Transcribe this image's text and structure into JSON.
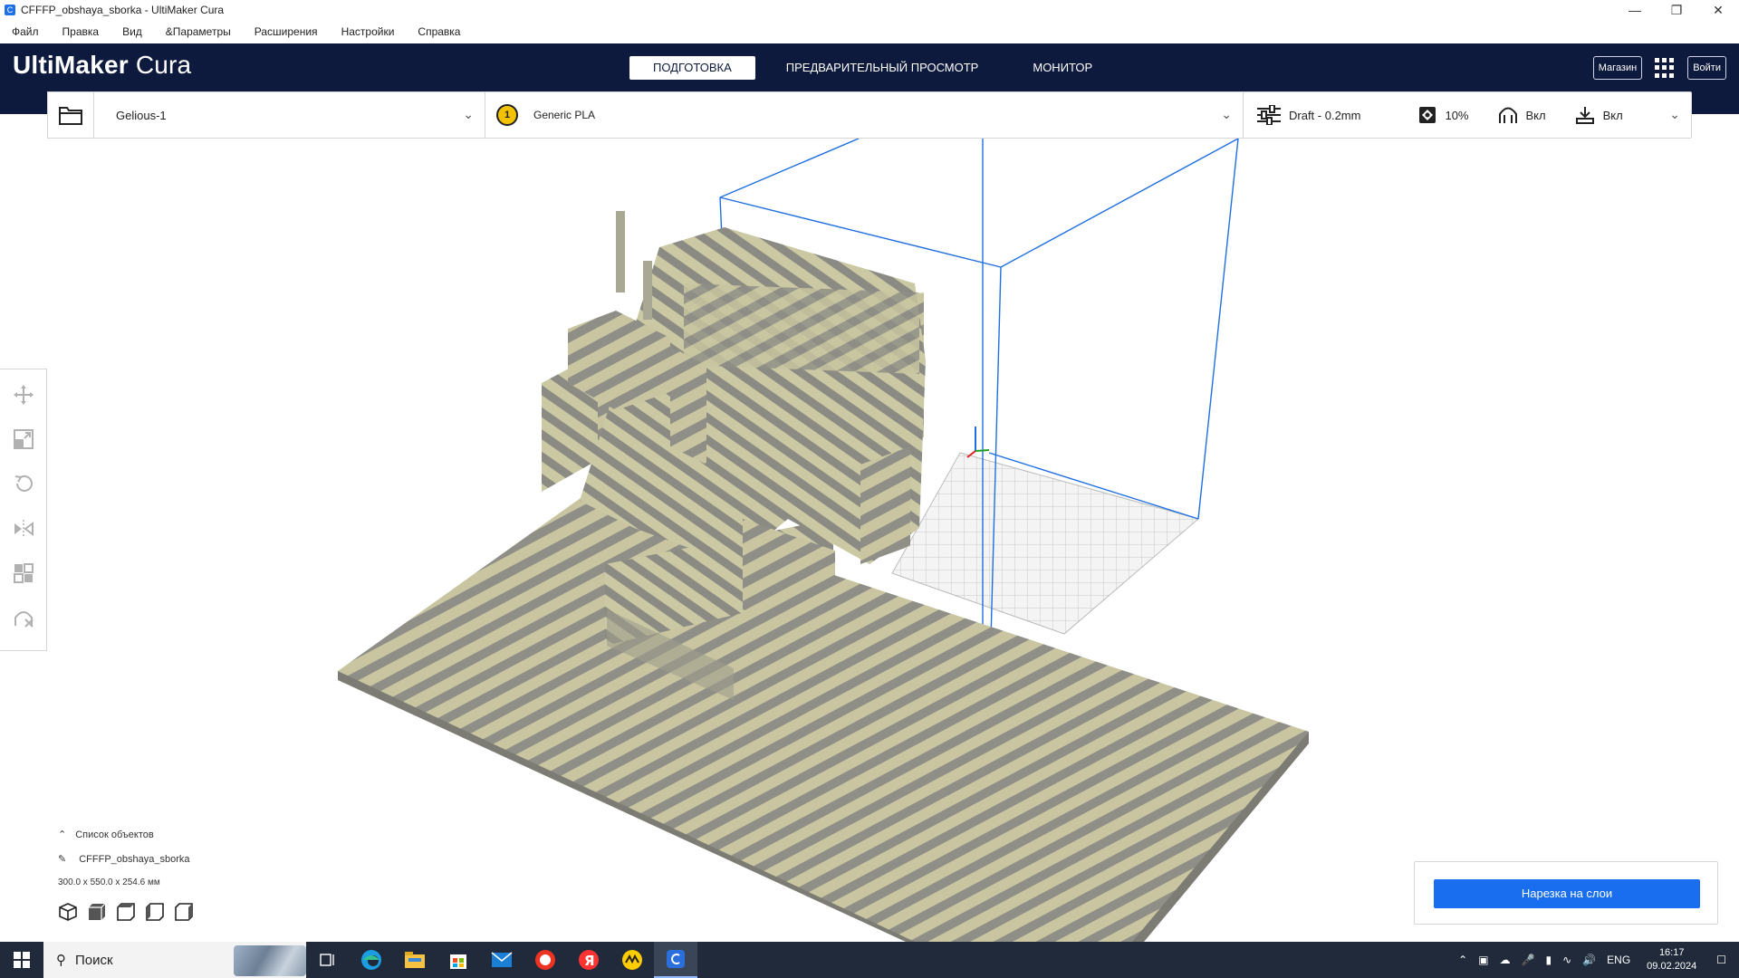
{
  "window": {
    "title": "CFFFP_obshaya_sborka - UltiMaker Cura"
  },
  "menu": [
    "Файл",
    "Правка",
    "Вид",
    "&Параметры",
    "Расширения",
    "Настройки",
    "Справка"
  ],
  "header": {
    "logo_bold": "UltiMaker",
    "logo_light": "Cura",
    "tabs": [
      {
        "label": "ПОДГОТОВКА",
        "active": true
      },
      {
        "label": "ПРЕДВАРИТЕЛЬНЫЙ ПРОСМОТР",
        "active": false
      },
      {
        "label": "МОНИТОР",
        "active": false
      }
    ],
    "marketplace_label": "Магазин",
    "signin_label": "Войти"
  },
  "config": {
    "printer": "Gelious-1",
    "extruder_number": "1",
    "material": "Generic PLA",
    "profile": "Draft - 0.2mm",
    "infill": "10%",
    "support": "Вкл",
    "adhesion": "Вкл"
  },
  "object_list": {
    "header": "Список объектов",
    "object_name": "CFFFP_obshaya_sborka",
    "dimensions": "300.0 x 550.0 x 254.6 мм"
  },
  "slice": {
    "button_label": "Нарезка на слои"
  },
  "taskbar": {
    "search_placeholder": "Поиск",
    "language": "ENG",
    "time": "16:17",
    "date": "09.02.2024"
  },
  "colors": {
    "header_bg": "#0d1a3d",
    "accent_blue": "#196ef0",
    "model_yellow": "#c8c5a0",
    "model_gray": "#8e8e86"
  }
}
